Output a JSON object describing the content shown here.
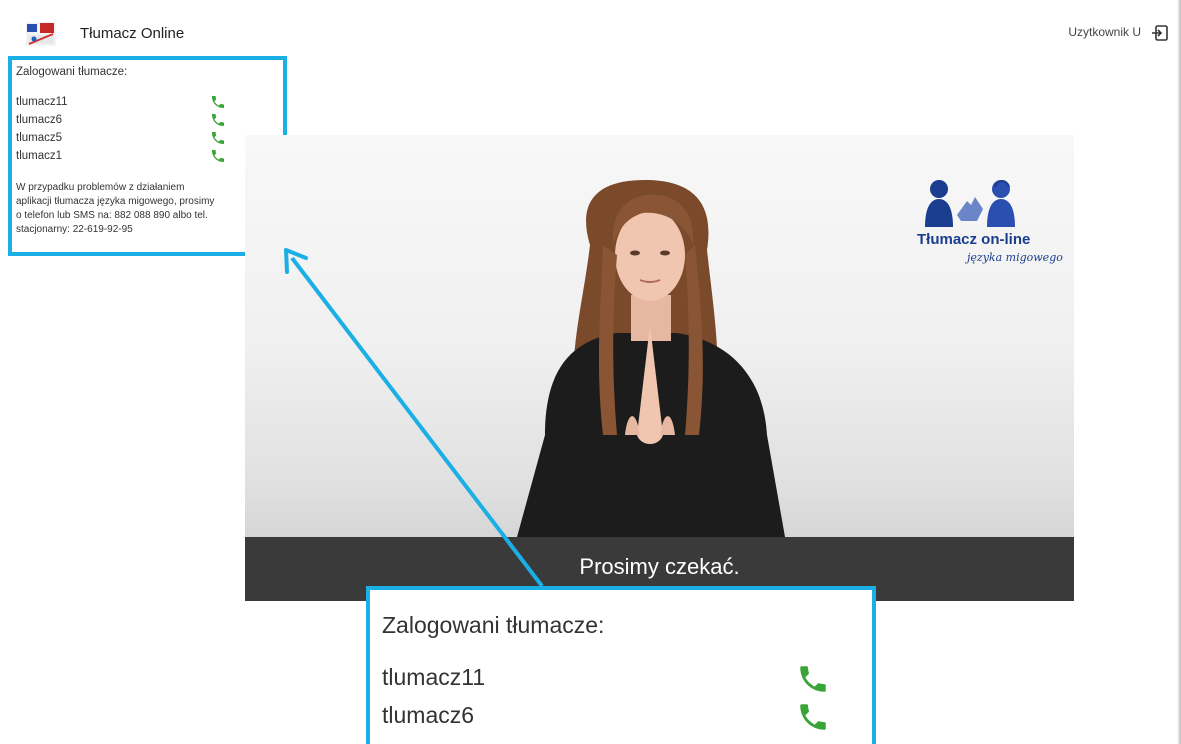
{
  "header": {
    "app_title": "Tłumacz Online",
    "user_name": "Uzytkownik U",
    "logo_icon": "app-logo-icon",
    "logout_icon": "logout-icon"
  },
  "sidebar": {
    "heading": "Zalogowani tłumacze:",
    "interpreters": [
      {
        "name": "tlumacz11",
        "icon": "phone-icon",
        "status_color": "#3aa537"
      },
      {
        "name": "tlumacz6",
        "icon": "phone-icon",
        "status_color": "#3aa537"
      },
      {
        "name": "tlumacz5",
        "icon": "phone-icon",
        "status_color": "#3aa537"
      },
      {
        "name": "tlumacz1",
        "icon": "phone-icon",
        "status_color": "#3aa537"
      }
    ],
    "info_lines": [
      "W przypadku problemów z działaniem",
      "aplikacji tłumacza języka migowego, prosimy",
      "o telefon lub SMS na: 882 088 890 albo tel.",
      "stacjonarny: 22-619-92-95"
    ]
  },
  "video": {
    "caption": "Prosimy czekać.",
    "brand_title": "Tłumacz on-line",
    "brand_subtitle": "języka migowego"
  },
  "zoom": {
    "heading": "Zalogowani tłumacze:",
    "interpreters": [
      {
        "name": "tlumacz11",
        "icon": "phone-icon"
      },
      {
        "name": "tlumacz6",
        "icon": "phone-icon"
      }
    ]
  },
  "colors": {
    "accent": "#1ab0e6",
    "phone": "#3aa537",
    "brand": "#1b3d8f",
    "caption_band": "#3a3a3a"
  }
}
